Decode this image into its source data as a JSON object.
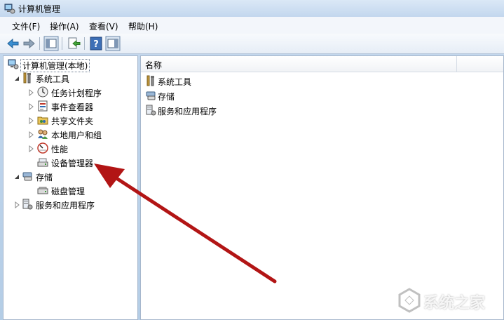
{
  "window": {
    "title": "计算机管理"
  },
  "menu": [
    {
      "label": "文件(F)"
    },
    {
      "label": "操作(A)"
    },
    {
      "label": "查看(V)"
    },
    {
      "label": "帮助(H)"
    }
  ],
  "toolbar": {
    "buttons": [
      "back-icon",
      "forward-icon",
      "show-hide-tree-icon",
      "export-list-icon",
      "help-icon",
      "show-hide-action-pane-icon"
    ]
  },
  "tree": {
    "root": {
      "label": "计算机管理(本地)"
    },
    "items": [
      {
        "label": "系统工具",
        "icon": "tools-icon",
        "expanded": true
      },
      {
        "label": "任务计划程序",
        "icon": "clock-icon"
      },
      {
        "label": "事件查看器",
        "icon": "event-viewer-icon"
      },
      {
        "label": "共享文件夹",
        "icon": "shared-folder-icon"
      },
      {
        "label": "本地用户和组",
        "icon": "users-icon"
      },
      {
        "label": "性能",
        "icon": "performance-icon"
      },
      {
        "label": "设备管理器",
        "icon": "device-manager-icon"
      },
      {
        "label": "存储",
        "icon": "storage-icon",
        "expanded": true
      },
      {
        "label": "磁盘管理",
        "icon": "disk-icon"
      },
      {
        "label": "服务和应用程序",
        "icon": "services-icon"
      }
    ]
  },
  "list": {
    "column_name": "名称",
    "rows": [
      {
        "label": "系统工具",
        "icon": "tools-icon"
      },
      {
        "label": "存储",
        "icon": "storage-icon"
      },
      {
        "label": "服务和应用程序",
        "icon": "services-icon"
      }
    ]
  },
  "annotation": {
    "color": "#b21515"
  },
  "watermark": {
    "text": "系统之家"
  }
}
